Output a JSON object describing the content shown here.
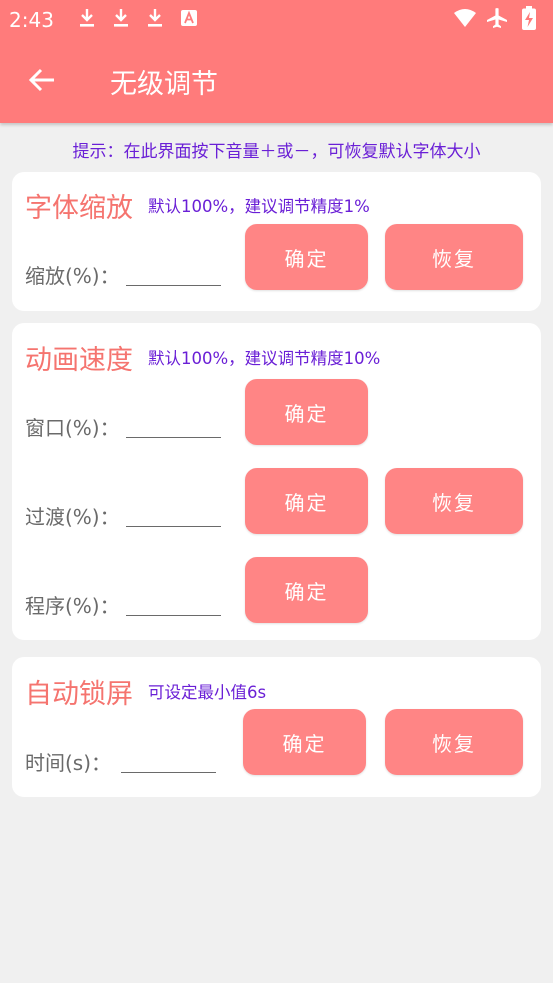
{
  "status_bar": {
    "time": "2:43",
    "notification_icons": [
      "download-icon",
      "download-icon",
      "download-icon",
      "a-box-icon"
    ],
    "system_icons": [
      "wifi-icon",
      "airplane-icon",
      "battery-charging-icon"
    ]
  },
  "header": {
    "title": "无级调节",
    "back_icon": "arrow-left-icon",
    "background_color": "#ff7b7b"
  },
  "hint": "提示：在此界面按下音量＋或－，可恢复默认字体大小",
  "font_scale": {
    "title": "字体缩放",
    "subtitle": "默认100%，建议调节精度1%",
    "field_label": "缩放(%)：",
    "confirm_label": "确定",
    "restore_label": "恢复"
  },
  "animation_speed": {
    "title": "动画速度",
    "subtitle": "默认100%，建议调节精度10%",
    "window": {
      "label": "窗口(%)：",
      "confirm_label": "确定"
    },
    "transition": {
      "label": "过渡(%)：",
      "confirm_label": "确定",
      "restore_label": "恢复"
    },
    "program": {
      "label": "程序(%)：",
      "confirm_label": "确定"
    }
  },
  "auto_lock": {
    "title": "自动锁屏",
    "subtitle": "可设定最小值6s",
    "field_label": "时间(s)：",
    "confirm_label": "确定",
    "restore_label": "恢复"
  },
  "colors": {
    "accent": "#ff8585",
    "title_text": "#f5746f",
    "subtitle_text": "#6a1fd6",
    "background": "#f0f0f0"
  }
}
